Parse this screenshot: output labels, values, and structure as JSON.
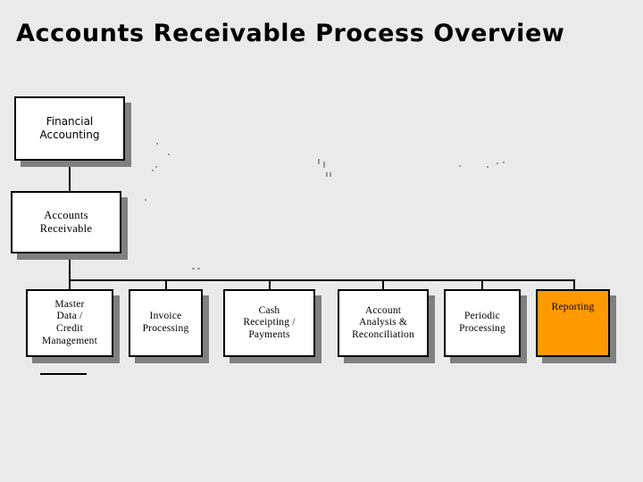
{
  "slide": {
    "title": "Accounts Receivable Process Overview",
    "background_color": "#eaeaea",
    "accent_color": "#ff9900",
    "shadow_color": "#808080",
    "border_color": "#000000",
    "node_fill_color": "#ffffff"
  },
  "chart_data": {
    "type": "diagram",
    "diagram_kind": "hierarchy-tree",
    "title": "Accounts Receivable Process Overview",
    "levels": [
      {
        "level": 1,
        "nodes": [
          {
            "id": "financial-accounting",
            "label": "Financial\nAccounting",
            "highlighted": false
          }
        ]
      },
      {
        "level": 2,
        "nodes": [
          {
            "id": "accounts-receivable",
            "label": "Accounts\nReceivable",
            "highlighted": false
          }
        ]
      },
      {
        "level": 3,
        "nodes": [
          {
            "id": "master-data-credit-management",
            "label": "Master\nData /\nCredit\nManagement",
            "highlighted": false
          },
          {
            "id": "invoice-processing",
            "label": "Invoice\nProcessing",
            "highlighted": false
          },
          {
            "id": "cash-receipting-payments",
            "label": "Cash\nReceipting /\nPayments",
            "highlighted": false
          },
          {
            "id": "account-analysis-reconciliation",
            "label": "Account\nAnalysis &\nReconciliation",
            "highlighted": false
          },
          {
            "id": "periodic-processing",
            "label": "Periodic\nProcessing",
            "highlighted": false
          },
          {
            "id": "reporting",
            "label": "Reporting",
            "highlighted": true
          }
        ]
      }
    ],
    "edges": [
      {
        "from": "financial-accounting",
        "to": "accounts-receivable"
      },
      {
        "from": "accounts-receivable",
        "to": "master-data-credit-management"
      },
      {
        "from": "accounts-receivable",
        "to": "invoice-processing"
      },
      {
        "from": "accounts-receivable",
        "to": "cash-receipting-payments"
      },
      {
        "from": "accounts-receivable",
        "to": "account-analysis-reconciliation"
      },
      {
        "from": "accounts-receivable",
        "to": "periodic-processing"
      },
      {
        "from": "accounts-receivable",
        "to": "reporting"
      }
    ]
  },
  "nodes": {
    "financial_accounting": "Financial\nAccounting",
    "accounts_receivable": "Accounts\nReceivable",
    "master_data": "Master\nData /\nCredit\nManagement",
    "invoice_processing": "Invoice\nProcessing",
    "cash_receipting": "Cash\nReceipting /\nPayments",
    "account_analysis": "Account\nAnalysis &\nReconciliation",
    "periodic_processing": "Periodic\nProcessing",
    "reporting": "Reporting"
  }
}
